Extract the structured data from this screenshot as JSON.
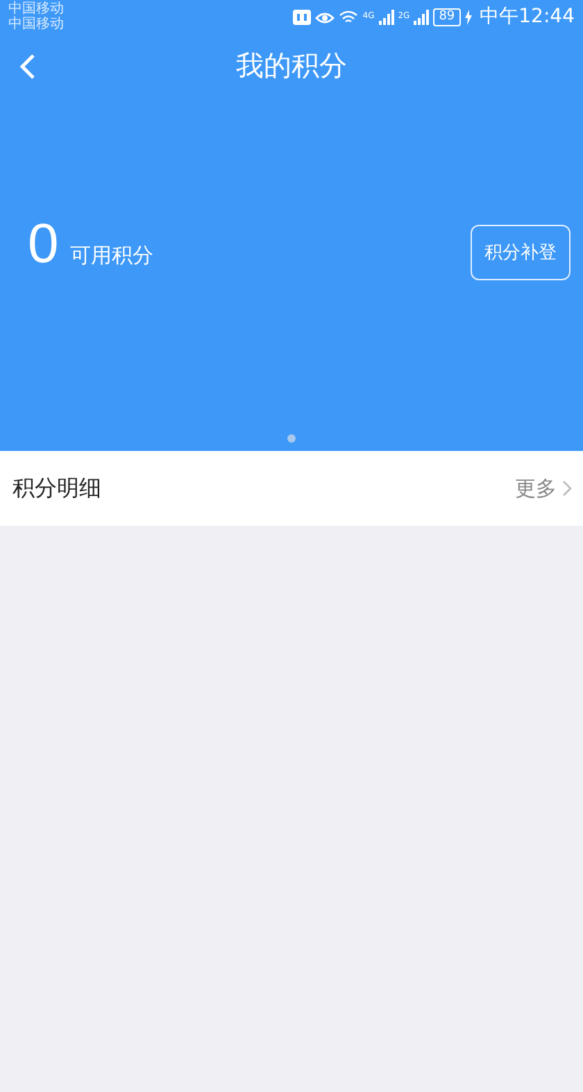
{
  "status_bar": {
    "carriers": [
      "中国移动",
      "中国移动"
    ],
    "network_1": "4G",
    "network_2": "2G",
    "battery": "89",
    "time": "中午12:44"
  },
  "nav": {
    "title": "我的积分"
  },
  "points": {
    "value": "0",
    "label": "可用积分",
    "button": "积分补登"
  },
  "pager": [
    {
      "selected": true
    }
  ],
  "detail_row": {
    "label": "积分明细",
    "more": "更多"
  }
}
